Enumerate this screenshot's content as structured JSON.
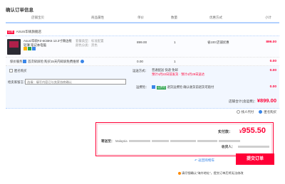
{
  "page_title": "确认订单信息",
  "columns": {
    "store": "店铺宝贝",
    "attrs": "商品属性",
    "price": "单价",
    "qty": "数量",
    "promo": "优惠方式",
    "subtotal": "小计"
  },
  "store": {
    "tag": "店铺",
    "name": "ASUS华硕旗舰店"
  },
  "item": {
    "name": "Asus/华硕FZ-6CBK6 13.3寸微边框 轻薄 笔记本电脑",
    "attr_line1": "套餐类型：标准配置",
    "attr_line2": "颜色分类：黑色",
    "price": "899.00",
    "qty": "1",
    "promo": "省100:店铺优惠",
    "subtotal": "899.00",
    "thumb_icon": "laptop-product-image"
  },
  "service": {
    "label": "保价服务",
    "text": "首次碎屏险 购买15天内碎屏免费维修",
    "price": "0.00",
    "qty": "1",
    "subtotal": "0.00"
  },
  "options": {
    "anonymous": "匿名购买",
    "message_label": "给卖家留言：",
    "message_placeholder": "选填：填写内容已与卖家协商确认",
    "shipping_label": "运送方式：",
    "shipping_line1": "普通配送 快递 免邮",
    "shipping_line2": "预计4月22日前发货 · 预计4月29日送达",
    "shipping_fee": "0.00",
    "insurance_label": "运费险：",
    "insurance_tag": "运费险",
    "insurance_text": "退货运费险 确认收货前退货可赔付",
    "insurance_fee": "0.00",
    "store_total_label": "店铺合计(含运费)：",
    "store_total": "¥899.00"
  },
  "pay_options": {
    "proxy": "找人代付",
    "anon_buy": "匿名购买"
  },
  "confirm": {
    "pay_label": "实付款：",
    "currency": "¥",
    "amount": "955.50",
    "addr_label": "寄送至：",
    "addr_text": "Malaysia",
    "recv_label": "收货人：",
    "back_label": "返回购物车",
    "submit_label": "提交订单"
  },
  "footer_note": "请仔细确认“海外地址”，提交订单后将无法修改",
  "colors": {
    "accent_red": "#ff0036",
    "link_blue": "#3a86e8",
    "line_blue": "#b2d1ff"
  }
}
